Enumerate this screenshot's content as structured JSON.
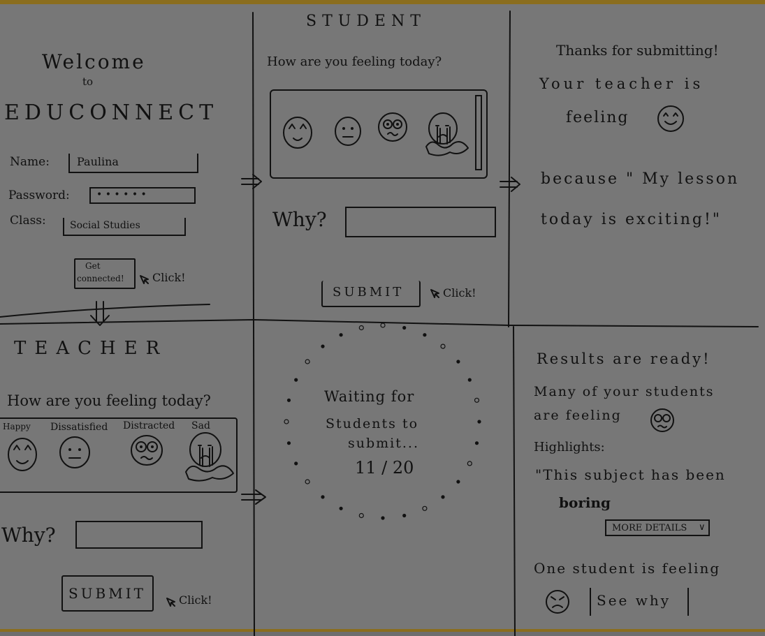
{
  "login": {
    "welcome": "Welcome",
    "to": "to",
    "app_name": "EDUCONNECT",
    "name_label": "Name:",
    "name_value": "Paulina",
    "password_label": "Password:",
    "password_value": "• • • • • •",
    "class_label": "Class:",
    "class_value": "Social Studies",
    "button_line1": "Get",
    "button_line2": "connected!",
    "click": "Click!"
  },
  "student": {
    "title": "STUDENT",
    "question": "How are you feeling today?",
    "why": "Why?",
    "submit": "SUBMIT",
    "click": "Click!",
    "moods": [
      "happy-face-icon",
      "neutral-face-icon",
      "dizzy-face-icon",
      "crying-face-icon"
    ]
  },
  "student_thanks": {
    "line1": "Thanks for submitting!",
    "line2": "Your teacher is",
    "line3": "feeling",
    "line4": "because \" My lesson",
    "line5": "today is exciting!\""
  },
  "teacher": {
    "title": "TEACHER",
    "question": "How are you feeling today?",
    "moods": [
      {
        "label": "Happy",
        "icon": "happy-face-icon"
      },
      {
        "label": "Dissatisfied",
        "icon": "neutral-face-icon"
      },
      {
        "label": "Distracted",
        "icon": "dizzy-face-icon"
      },
      {
        "label": "Sad",
        "icon": "crying-face-icon"
      }
    ],
    "why": "Why?",
    "submit": "SUBMIT",
    "click": "Click!"
  },
  "waiting": {
    "line1": "Waiting for",
    "line2": "Students to",
    "line3": "submit...",
    "progress": "11 / 20",
    "submitted": 11,
    "total": 20
  },
  "results": {
    "line1": "Results are ready!",
    "line2": "Many of your students",
    "line3": "are feeling",
    "highlights": "Highlights:",
    "quote1": "\"This subject has been",
    "quote2": "boring",
    "more_details": "MORE DETAILS",
    "one_student": "One student is feeling",
    "see_why": "See why"
  }
}
